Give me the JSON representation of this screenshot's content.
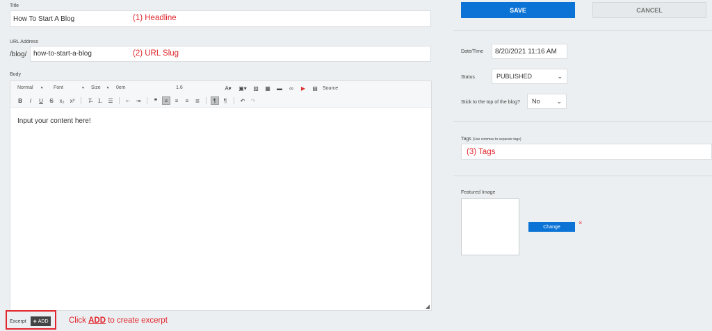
{
  "title_field": {
    "label": "Title",
    "value": "How To Start A Blog",
    "annotation": "(1) Headline"
  },
  "url_field": {
    "label": "URL Address",
    "prefix": "/blog/",
    "value": "how-to-start-a-blog",
    "annotation": "(2) URL Slug"
  },
  "body": {
    "label": "Body",
    "toolbar": {
      "format": "Normal",
      "font": "Font",
      "size": "Size",
      "indent": "0em",
      "line_height": "1.6",
      "source": "Source"
    },
    "content": "Input your content here!"
  },
  "excerpt": {
    "label": "Excerpt",
    "add_label": "ADD",
    "annotation_prefix": "Click ",
    "annotation_link": "ADD",
    "annotation_suffix": " to create excerpt"
  },
  "actions": {
    "save": "SAVE",
    "cancel": "CANCEL"
  },
  "meta": {
    "datetime_label": "Date/Time",
    "datetime_value": "8/20/2021 11:16 AM",
    "status_label": "Status",
    "status_value": "PUBLISHED",
    "sticky_label": "Stick to the top of the blog?",
    "sticky_value": "No"
  },
  "tags": {
    "label": "Tags",
    "hint": "(Use commas to separate tags)",
    "annotation": "(3) Tags"
  },
  "featured": {
    "label": "Featured Image",
    "change": "Change",
    "remove": "×"
  },
  "colors": {
    "primary": "#0b73d6",
    "annotation": "#e0262c"
  }
}
